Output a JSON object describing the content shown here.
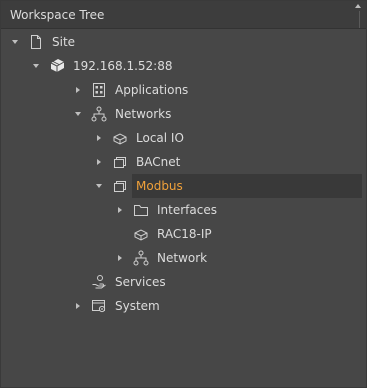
{
  "panel": {
    "title": "Workspace Tree"
  },
  "tree": {
    "site": "Site",
    "device": "192.168.1.52:88",
    "applications": "Applications",
    "networks": "Networks",
    "local_io": "Local IO",
    "bacnet": "BACnet",
    "modbus": "Modbus",
    "interfaces": "Interfaces",
    "rac18_ip": "RAC18-IP",
    "network": "Network",
    "services": "Services",
    "system": "System"
  },
  "colors": {
    "accent": "#f0a13a",
    "text": "#dcdcdc",
    "background": "#474747",
    "selected_row": "#393939"
  }
}
